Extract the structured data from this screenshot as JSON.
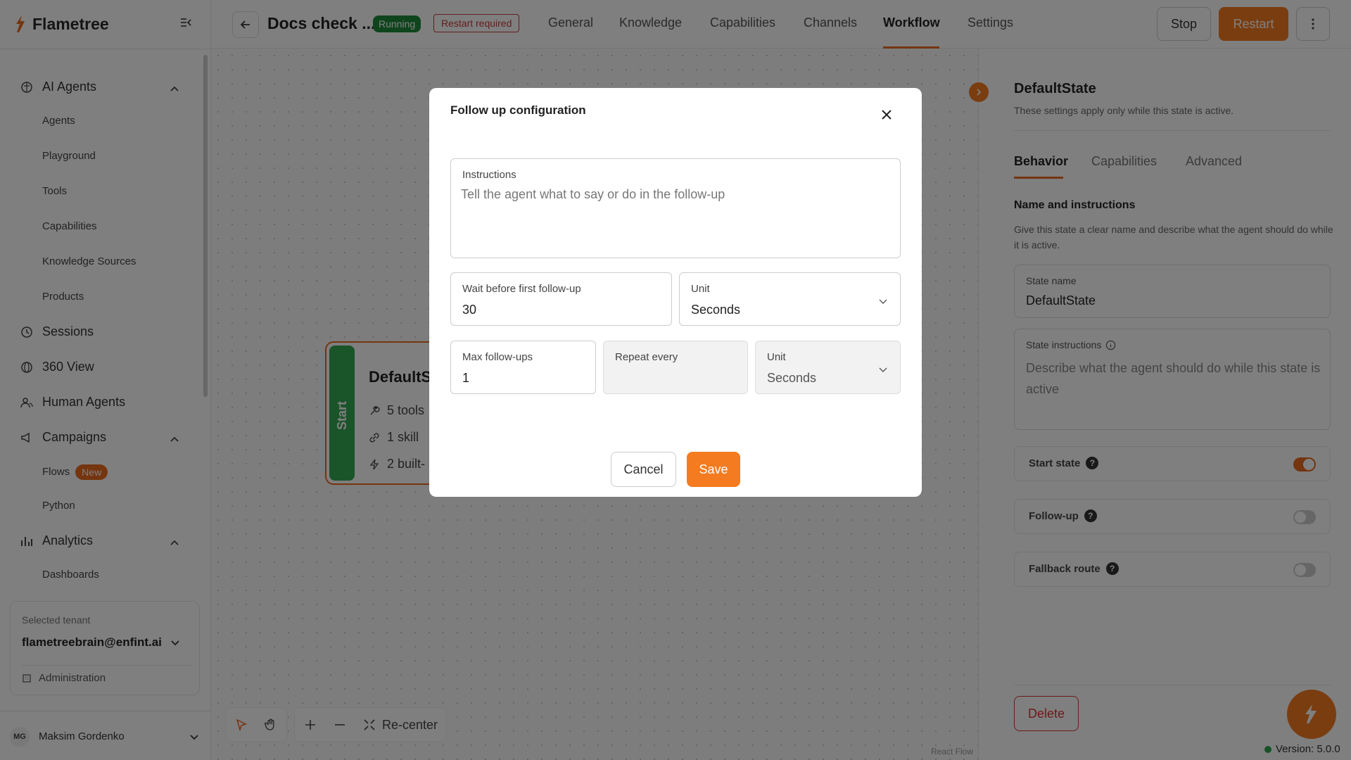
{
  "brand": {
    "name": "Flametree",
    "accent": "#f47b20"
  },
  "sidebar": {
    "sections": [
      {
        "label": "AI Agents",
        "icon": "brain-icon",
        "items": [
          "Agents",
          "Playground",
          "Tools",
          "Capabilities",
          "Knowledge Sources",
          "Products"
        ]
      },
      {
        "label": "Sessions",
        "icon": "clock-icon"
      },
      {
        "label": "360 View",
        "icon": "globe-icon"
      },
      {
        "label": "Human Agents",
        "icon": "users-icon"
      },
      {
        "label": "Campaigns",
        "icon": "megaphone-icon",
        "items": [
          "Flows",
          "Python"
        ],
        "flows_badge": "New"
      },
      {
        "label": "Analytics",
        "icon": "bar-chart-icon",
        "items": [
          "Dashboards"
        ]
      }
    ],
    "tenant": {
      "label": "Selected tenant",
      "value": "flametreebrain@enfint.ai",
      "admin": "Administration"
    },
    "user": {
      "initials": "MG",
      "name": "Maksim Gordenko"
    }
  },
  "header": {
    "title": "Docs check ...",
    "status": "Running",
    "warning": "Restart required",
    "tabs": [
      "General",
      "Knowledge",
      "Capabilities",
      "Channels",
      "Workflow",
      "Settings"
    ],
    "active_tab": "Workflow",
    "stop_label": "Stop",
    "restart_label": "Restart"
  },
  "canvas": {
    "node": {
      "start_label": "Start",
      "name": "DefaultS",
      "lines": [
        "5 tools",
        "1 skill",
        "2 built-"
      ]
    },
    "recenter_label": "Re-center",
    "attribution": "React Flow"
  },
  "right_panel": {
    "title": "DefaultState",
    "subtitle": "These settings apply only while this state is active.",
    "tabs": [
      "Behavior",
      "Capabilities",
      "Advanced"
    ],
    "section_heading": "Name and instructions",
    "section_help": "Give this state a clear name and describe what the agent should do while it is active.",
    "state_name_label": "State name",
    "state_name_value": "DefaultState",
    "instructions_label": "State instructions",
    "instructions_placeholder": "Describe what the agent should do while this state is active",
    "toggles": [
      {
        "label": "Start state",
        "on": true
      },
      {
        "label": "Follow-up",
        "on": false
      },
      {
        "label": "Fallback route",
        "on": false
      }
    ],
    "delete_label": "Delete"
  },
  "version": "Version: 5.0.0",
  "modal": {
    "title": "Follow up configuration",
    "instructions_label": "Instructions",
    "instructions_placeholder": "Tell the agent what to say or do in the follow-up",
    "wait_label": "Wait before first follow-up",
    "wait_value": "30",
    "unit_label": "Unit",
    "unit_value": "Seconds",
    "max_label": "Max follow-ups",
    "max_value": "1",
    "repeat_label": "Repeat every",
    "repeat_unit_label": "Unit",
    "repeat_unit_value": "Seconds",
    "cancel_label": "Cancel",
    "save_label": "Save"
  }
}
